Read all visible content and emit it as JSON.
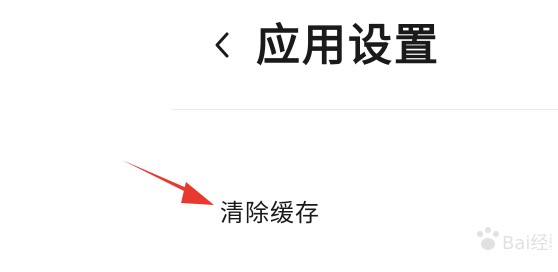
{
  "header": {
    "back_icon": "chevron-left-icon",
    "title": "应用设置"
  },
  "settings": {
    "items": [
      {
        "label": "清除缓存"
      }
    ]
  },
  "annotation": {
    "type": "arrow",
    "color": "#e8392e"
  },
  "watermark": {
    "text": "Bai经验",
    "color": "#c9c9c9"
  }
}
